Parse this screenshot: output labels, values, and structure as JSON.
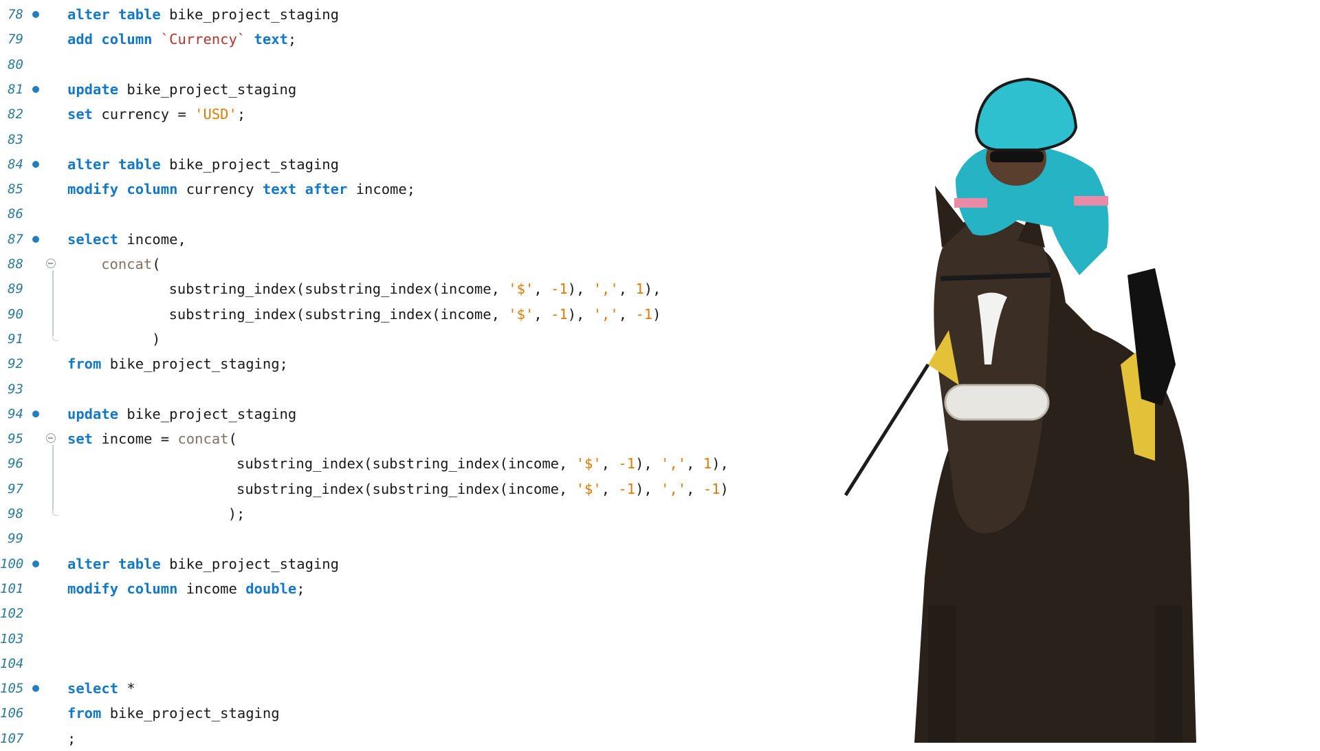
{
  "editor": {
    "lines": [
      {
        "n": "78",
        "bp": true,
        "indent": 0,
        "tokens": [
          [
            "kw",
            "alter"
          ],
          [
            "t",
            " "
          ],
          [
            "kw",
            "table"
          ],
          [
            "t",
            " bike_project_staging"
          ]
        ]
      },
      {
        "n": "79",
        "indent": 0,
        "tokens": [
          [
            "kw",
            "add"
          ],
          [
            "t",
            " "
          ],
          [
            "kw",
            "column"
          ],
          [
            "t",
            " "
          ],
          [
            "bq",
            "`Currency`"
          ],
          [
            "t",
            " "
          ],
          [
            "kw",
            "text"
          ],
          [
            "t",
            ";"
          ]
        ]
      },
      {
        "n": "80",
        "indent": 0,
        "tokens": []
      },
      {
        "n": "81",
        "bp": true,
        "indent": 0,
        "tokens": [
          [
            "kw",
            "update"
          ],
          [
            "t",
            " bike_project_staging"
          ]
        ]
      },
      {
        "n": "82",
        "indent": 0,
        "tokens": [
          [
            "kw",
            "set"
          ],
          [
            "t",
            " currency = "
          ],
          [
            "str",
            "'USD'"
          ],
          [
            "t",
            ";"
          ]
        ]
      },
      {
        "n": "83",
        "indent": 0,
        "tokens": []
      },
      {
        "n": "84",
        "bp": true,
        "indent": 0,
        "tokens": [
          [
            "kw",
            "alter"
          ],
          [
            "t",
            " "
          ],
          [
            "kw",
            "table"
          ],
          [
            "t",
            " bike_project_staging"
          ]
        ]
      },
      {
        "n": "85",
        "indent": 0,
        "tokens": [
          [
            "kw",
            "modify"
          ],
          [
            "t",
            " "
          ],
          [
            "kw",
            "column"
          ],
          [
            "t",
            " currency "
          ],
          [
            "kw",
            "text"
          ],
          [
            "t",
            " "
          ],
          [
            "kw",
            "after"
          ],
          [
            "t",
            " income;"
          ]
        ]
      },
      {
        "n": "86",
        "indent": 0,
        "tokens": []
      },
      {
        "n": "87",
        "bp": true,
        "indent": 0,
        "tokens": [
          [
            "kw",
            "select"
          ],
          [
            "t",
            " income,"
          ]
        ]
      },
      {
        "n": "88",
        "fold": true,
        "indent": 4,
        "tokens": [
          [
            "fn",
            "concat"
          ],
          [
            "t",
            "("
          ]
        ]
      },
      {
        "n": "89",
        "indent": 12,
        "tokens": [
          [
            "t",
            "substring_index(substring_index(income, "
          ],
          [
            "str",
            "'$'"
          ],
          [
            "t",
            ", "
          ],
          [
            "num",
            "-1"
          ],
          [
            "t",
            "), "
          ],
          [
            "str",
            "','"
          ],
          [
            "t",
            ", "
          ],
          [
            "num",
            "1"
          ],
          [
            "t",
            "),"
          ]
        ]
      },
      {
        "n": "90",
        "indent": 12,
        "tokens": [
          [
            "t",
            "substring_index(substring_index(income, "
          ],
          [
            "str",
            "'$'"
          ],
          [
            "t",
            ", "
          ],
          [
            "num",
            "-1"
          ],
          [
            "t",
            "), "
          ],
          [
            "str",
            "','"
          ],
          [
            "t",
            ", "
          ],
          [
            "num",
            "-1"
          ],
          [
            "t",
            ")"
          ]
        ]
      },
      {
        "n": "91",
        "indent": 10,
        "tokens": [
          [
            "t",
            ")"
          ]
        ]
      },
      {
        "n": "92",
        "indent": 0,
        "tokens": [
          [
            "kw",
            "from"
          ],
          [
            "t",
            " bike_project_staging;"
          ]
        ]
      },
      {
        "n": "93",
        "indent": 0,
        "tokens": []
      },
      {
        "n": "94",
        "bp": true,
        "indent": 0,
        "tokens": [
          [
            "kw",
            "update"
          ],
          [
            "t",
            " bike_project_staging"
          ]
        ]
      },
      {
        "n": "95",
        "fold": true,
        "indent": 0,
        "tokens": [
          [
            "kw",
            "set"
          ],
          [
            "t",
            " income = "
          ],
          [
            "fn",
            "concat"
          ],
          [
            "t",
            "("
          ]
        ]
      },
      {
        "n": "96",
        "indent": 20,
        "tokens": [
          [
            "t",
            "substring_index(substring_index(income, "
          ],
          [
            "str",
            "'$'"
          ],
          [
            "t",
            ", "
          ],
          [
            "num",
            "-1"
          ],
          [
            "t",
            "), "
          ],
          [
            "str",
            "','"
          ],
          [
            "t",
            ", "
          ],
          [
            "num",
            "1"
          ],
          [
            "t",
            "),"
          ]
        ]
      },
      {
        "n": "97",
        "indent": 20,
        "tokens": [
          [
            "t",
            "substring_index(substring_index(income, "
          ],
          [
            "str",
            "'$'"
          ],
          [
            "t",
            ", "
          ],
          [
            "num",
            "-1"
          ],
          [
            "t",
            "), "
          ],
          [
            "str",
            "','"
          ],
          [
            "t",
            ", "
          ],
          [
            "num",
            "-1"
          ],
          [
            "t",
            ")"
          ]
        ]
      },
      {
        "n": "98",
        "indent": 19,
        "tokens": [
          [
            "t",
            ");"
          ]
        ]
      },
      {
        "n": "99",
        "indent": 0,
        "tokens": []
      },
      {
        "n": "100",
        "bp": true,
        "indent": 0,
        "tokens": [
          [
            "kw",
            "alter"
          ],
          [
            "t",
            " "
          ],
          [
            "kw",
            "table"
          ],
          [
            "t",
            " bike_project_staging"
          ]
        ]
      },
      {
        "n": "101",
        "indent": 0,
        "tokens": [
          [
            "kw",
            "modify"
          ],
          [
            "t",
            " "
          ],
          [
            "kw",
            "column"
          ],
          [
            "t",
            " income "
          ],
          [
            "kw",
            "double"
          ],
          [
            "t",
            ";"
          ]
        ]
      },
      {
        "n": "102",
        "indent": 0,
        "tokens": []
      },
      {
        "n": "103",
        "indent": 0,
        "tokens": []
      },
      {
        "n": "104",
        "indent": 0,
        "tokens": []
      },
      {
        "n": "105",
        "bp": true,
        "indent": 0,
        "tokens": [
          [
            "kw",
            "select"
          ],
          [
            "t",
            " *"
          ]
        ]
      },
      {
        "n": "106",
        "indent": 0,
        "tokens": [
          [
            "kw",
            "from"
          ],
          [
            "t",
            " bike_project_staging"
          ]
        ]
      },
      {
        "n": "107",
        "indent": 0,
        "tokens": [
          [
            "t",
            ";"
          ]
        ]
      }
    ]
  },
  "image": {
    "subject": "racehorse-with-jockey"
  },
  "colors": {
    "keyword": "#1478c8",
    "string": "#e07b00",
    "function": "#7d7466",
    "line_number": "#2b7a9a",
    "breakpoint": "#1f7fc1"
  }
}
